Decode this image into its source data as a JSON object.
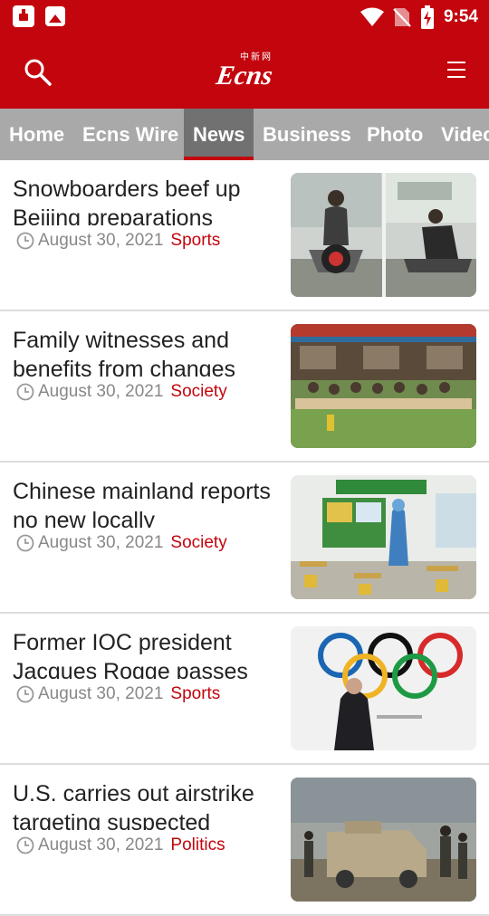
{
  "status_bar": {
    "time": "9:54",
    "icons": [
      "notification-icon",
      "image-icon",
      "wifi-icon",
      "no-sim-icon",
      "battery-charging-icon"
    ]
  },
  "app_bar": {
    "logo_text": "Ecns",
    "logo_small_text": "中新网",
    "icons": [
      "search-icon",
      "menu-icon"
    ]
  },
  "colors": {
    "brand_red": "#c3050d",
    "tab_bar": "#a9a9a9",
    "tab_active": "#717171",
    "meta_gray": "#888888"
  },
  "tabs": [
    {
      "label": "Home",
      "active": false
    },
    {
      "label": "Ecns Wire",
      "active": false
    },
    {
      "label": "News",
      "active": true
    },
    {
      "label": "Business",
      "active": false
    },
    {
      "label": "Photo",
      "active": false
    },
    {
      "label": "Video",
      "active": false
    }
  ],
  "articles": [
    {
      "title": "Snowboarders beef up Beijing preparations",
      "date": "August 30, 2021",
      "category": "Sports",
      "image": "gym-training-photo"
    },
    {
      "title": "Family witnesses and benefits from changes",
      "date": "August 30, 2021",
      "category": "Society",
      "image": "family-outdoor-photo"
    },
    {
      "title": "Chinese mainland reports no new locally",
      "date": "August 30, 2021",
      "category": "Society",
      "image": "classroom-disinfection-photo"
    },
    {
      "title": "Former IOC president Jacques Rogge passes",
      "date": "August 30, 2021",
      "category": "Sports",
      "image": "olympic-rings-photo"
    },
    {
      "title": "U.S. carries out airstrike targeting suspected",
      "date": "August 30, 2021",
      "category": "Politics",
      "image": "military-vehicle-photo"
    }
  ]
}
